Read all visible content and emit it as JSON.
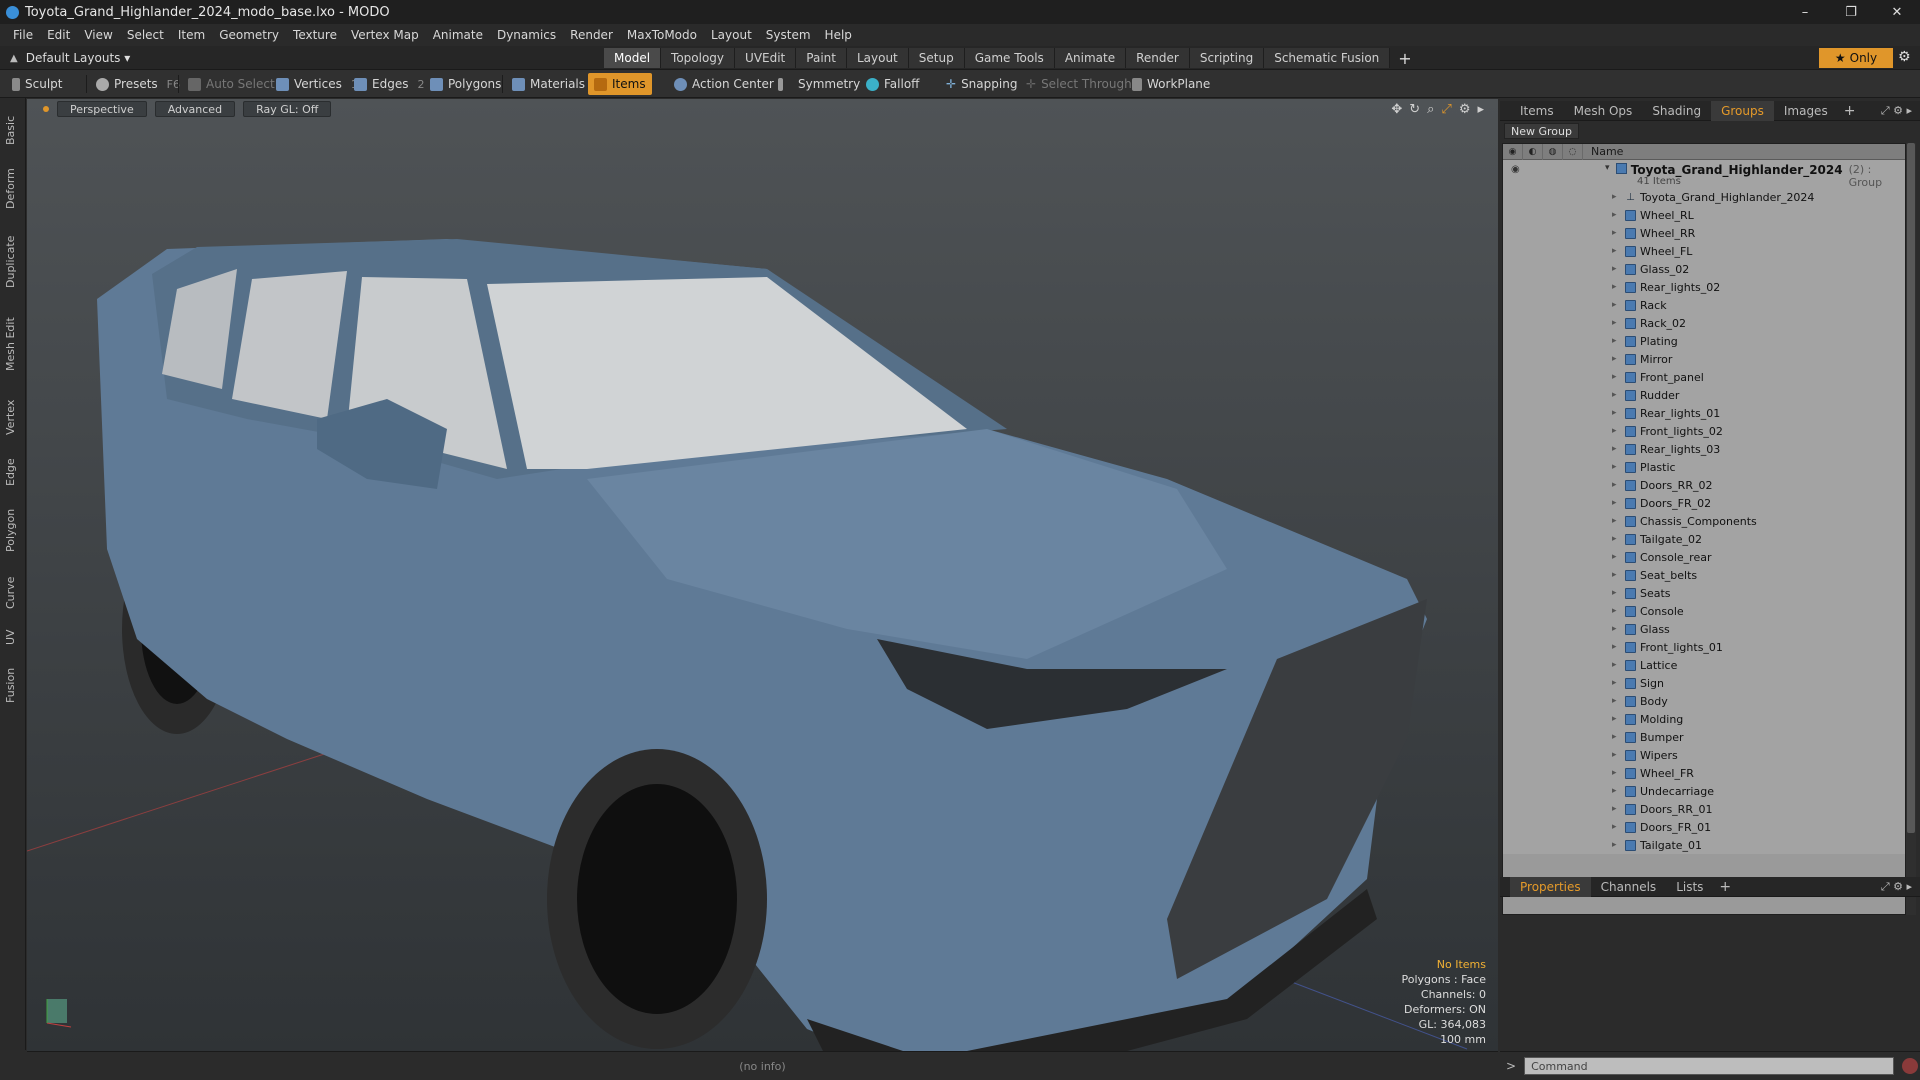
{
  "window": {
    "title": "Toyota_Grand_Highlander_2024_modo_base.lxo - MODO",
    "controls": [
      "–",
      "❐",
      "✕"
    ]
  },
  "menu": [
    "File",
    "Edit",
    "View",
    "Select",
    "Item",
    "Geometry",
    "Texture",
    "Vertex Map",
    "Animate",
    "Dynamics",
    "Render",
    "MaxToModo",
    "Layout",
    "System",
    "Help"
  ],
  "layouts": {
    "selector": "Default Layouts ▾",
    "tabs": [
      "Model",
      "Topology",
      "UVEdit",
      "Paint",
      "Layout",
      "Setup",
      "Game Tools",
      "Animate",
      "Render",
      "Scripting",
      "Schematic Fusion"
    ],
    "active_tab": "Model",
    "only_label": "Only"
  },
  "toolbar": {
    "sculpt": "Sculpt",
    "presets": "Presets",
    "presets_key": "F6",
    "auto_select": "Auto Select",
    "vertices": "Vertices",
    "vertices_key": "1",
    "edges": "Edges",
    "edges_key": "2",
    "polygons": "Polygons",
    "materials": "Materials",
    "items": "Items",
    "action_center": "Action Center",
    "symmetry": "Symmetry",
    "falloff": "Falloff",
    "snapping": "Snapping",
    "select_through": "Select Through",
    "workplane": "WorkPlane"
  },
  "left_tabs": [
    "Basic",
    "Deform",
    "Duplicate",
    "Mesh Edit",
    "Vertex",
    "Edge",
    "Polygon",
    "Curve",
    "UV",
    "Fusion"
  ],
  "viewport": {
    "view": "Perspective",
    "shading": "Advanced",
    "raygl": "Ray GL: Off",
    "info": {
      "items": "No Items",
      "polygons": "Polygons : Face",
      "channels": "Channels: 0",
      "deformers": "Deformers: ON",
      "gl": "GL: 364,083",
      "scale": "100 mm"
    }
  },
  "status": "(no info)",
  "panel_tabs": {
    "tabs": [
      "Items",
      "Mesh Ops",
      "Shading",
      "Groups",
      "Images"
    ],
    "active": "Groups"
  },
  "groups": {
    "new_group": "New Group",
    "column_name": "Name",
    "root": {
      "name": "Toyota_Grand_Highlander_2024",
      "extra": "(2) : Group",
      "count": "41 Items"
    },
    "items": [
      "Toyota_Grand_Highlander_2024",
      "Wheel_RL",
      "Wheel_RR",
      "Wheel_FL",
      "Glass_02",
      "Rear_lights_02",
      "Rack",
      "Rack_02",
      "Plating",
      "Mirror",
      "Front_panel",
      "Rudder",
      "Rear_lights_01",
      "Front_lights_02",
      "Rear_lights_03",
      "Plastic",
      "Doors_RR_02",
      "Doors_FR_02",
      "Chassis_Components",
      "Tailgate_02",
      "Console_rear",
      "Seat_belts",
      "Seats",
      "Console",
      "Glass",
      "Front_lights_01",
      "Lattice",
      "Sign",
      "Body",
      "Molding",
      "Bumper",
      "Wipers",
      "Wheel_FR",
      "Undecarriage",
      "Doors_RR_01",
      "Doors_FR_01",
      "Tailgate_01"
    ]
  },
  "lower_tabs": {
    "tabs": [
      "Properties",
      "Channels",
      "Lists"
    ],
    "active": "Properties"
  },
  "command": {
    "placeholder": "Command"
  },
  "colors": {
    "accent": "#e0962a",
    "car_body": "#5f7a96"
  }
}
